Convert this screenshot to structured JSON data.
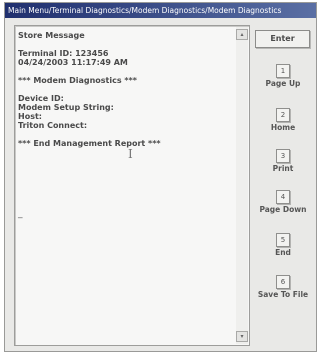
{
  "window": {
    "title": "Main Menu/Terminal Diagnostics/Modem Diagnostics/Modem Diagnostics"
  },
  "report": {
    "lines": [
      "Store Message",
      "",
      "Terminal ID: 123456",
      "04/24/2003 11:17:49 AM",
      "",
      "*** Modem Diagnostics ***",
      "",
      "Device ID:",
      "Modem Setup String:",
      "Host:",
      "Triton Connect:",
      "",
      "*** End Management Report ***"
    ],
    "trailing_mark": "_",
    "cursor_glyph": "I"
  },
  "scrollbar": {
    "up_arrow": "▴",
    "down_arrow": "▾"
  },
  "buttons": {
    "enter_label": "Enter",
    "function_keys": [
      {
        "key": "1",
        "label": "Page Up"
      },
      {
        "key": "2",
        "label": "Home"
      },
      {
        "key": "3",
        "label": "Print"
      },
      {
        "key": "4",
        "label": "Page Down"
      },
      {
        "key": "5",
        "label": "End"
      },
      {
        "key": "6",
        "label": "Save To File"
      }
    ]
  },
  "colors": {
    "titlebar_start": "#1f2f6e",
    "titlebar_end": "#5a6fa4",
    "panel_background": "#e9e9e7"
  }
}
